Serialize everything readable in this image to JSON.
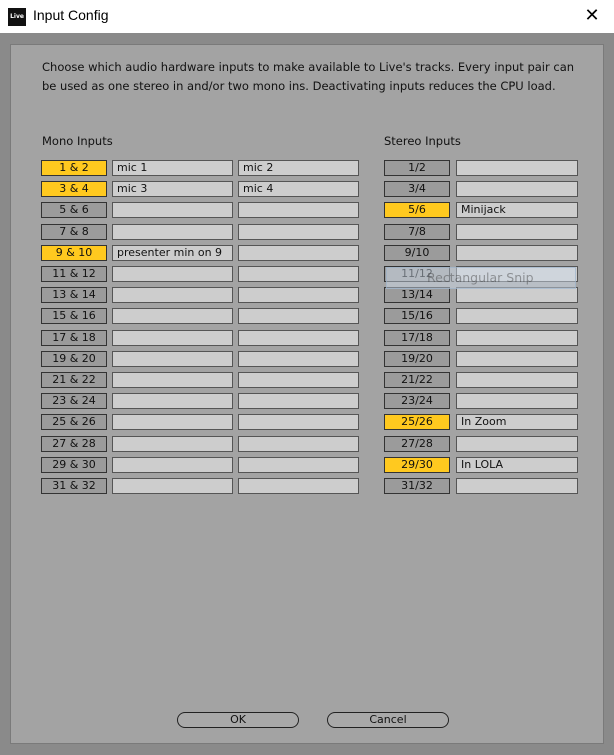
{
  "window": {
    "icon_text": "Live",
    "title": "Input Config",
    "close_glyph": "✕"
  },
  "description": "Choose which audio hardware inputs to make available to Live's tracks. Every input pair can be used as one stereo in and/or two mono ins.  Deactivating inputs reduces the CPU load.",
  "mono": {
    "header": "Mono Inputs",
    "rows": [
      {
        "label": "1 & 2",
        "active": true,
        "left": "mic 1",
        "right": "mic 2"
      },
      {
        "label": "3 & 4",
        "active": true,
        "left": "mic 3",
        "right": "mic 4"
      },
      {
        "label": "5 & 6",
        "active": false,
        "left": "",
        "right": ""
      },
      {
        "label": "7 & 8",
        "active": false,
        "left": "",
        "right": ""
      },
      {
        "label": "9 & 10",
        "active": true,
        "left": "presenter min on 9",
        "right": ""
      },
      {
        "label": "11 & 12",
        "active": false,
        "left": "",
        "right": ""
      },
      {
        "label": "13 & 14",
        "active": false,
        "left": "",
        "right": ""
      },
      {
        "label": "15 & 16",
        "active": false,
        "left": "",
        "right": ""
      },
      {
        "label": "17 & 18",
        "active": false,
        "left": "",
        "right": ""
      },
      {
        "label": "19 & 20",
        "active": false,
        "left": "",
        "right": ""
      },
      {
        "label": "21 & 22",
        "active": false,
        "left": "",
        "right": ""
      },
      {
        "label": "23 & 24",
        "active": false,
        "left": "",
        "right": ""
      },
      {
        "label": "25 & 26",
        "active": false,
        "left": "",
        "right": ""
      },
      {
        "label": "27 & 28",
        "active": false,
        "left": "",
        "right": ""
      },
      {
        "label": "29 & 30",
        "active": false,
        "left": "",
        "right": ""
      },
      {
        "label": "31 & 32",
        "active": false,
        "left": "",
        "right": ""
      }
    ]
  },
  "stereo": {
    "header": "Stereo Inputs",
    "rows": [
      {
        "label": "1/2",
        "active": false,
        "name": ""
      },
      {
        "label": "3/4",
        "active": false,
        "name": ""
      },
      {
        "label": "5/6",
        "active": true,
        "name": "Minijack"
      },
      {
        "label": "7/8",
        "active": false,
        "name": ""
      },
      {
        "label": "9/10",
        "active": false,
        "name": ""
      },
      {
        "label": "11/12",
        "active": false,
        "name": ""
      },
      {
        "label": "13/14",
        "active": false,
        "name": ""
      },
      {
        "label": "15/16",
        "active": false,
        "name": ""
      },
      {
        "label": "17/18",
        "active": false,
        "name": ""
      },
      {
        "label": "19/20",
        "active": false,
        "name": ""
      },
      {
        "label": "21/22",
        "active": false,
        "name": ""
      },
      {
        "label": "23/24",
        "active": false,
        "name": ""
      },
      {
        "label": "25/26",
        "active": true,
        "name": "In Zoom"
      },
      {
        "label": "27/28",
        "active": false,
        "name": ""
      },
      {
        "label": "29/30",
        "active": true,
        "name": "In LOLA"
      },
      {
        "label": "31/32",
        "active": false,
        "name": ""
      }
    ]
  },
  "overlay": {
    "text": "Rectangular Snip"
  },
  "buttons": {
    "ok": "OK",
    "cancel": "Cancel"
  },
  "colors": {
    "active": "#ffc91f",
    "inactive": "#9b9b9b",
    "panel": "#a3a3a3"
  }
}
